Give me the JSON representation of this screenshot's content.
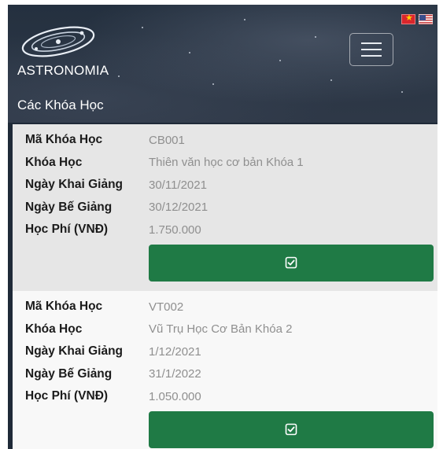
{
  "brand": {
    "name": "ASTRONOMIA"
  },
  "languages": [
    {
      "code": "vi",
      "icon": "vietnam-flag-icon"
    },
    {
      "code": "en",
      "icon": "us-flag-icon"
    }
  ],
  "nav": {
    "menu_icon": "hamburger-menu-icon"
  },
  "section": {
    "title": "Các Khóa Học"
  },
  "labels": {
    "code": "Mã Khóa Học",
    "course": "Khóa Học",
    "start": "Ngày Khai Giảng",
    "end": "Ngày Bế Giảng",
    "fee": "Học Phí (VNĐ)"
  },
  "courses": [
    {
      "code": "CB001",
      "name": "Thiên văn học cơ bản Khóa 1",
      "start": "30/11/2021",
      "end": "30/12/2021",
      "fee": "1.750.000",
      "button_icon": "checkbox-check-icon"
    },
    {
      "code": "VT002",
      "name": "Vũ Trụ Học Cơ Bản Khóa 2",
      "start": "1/12/2021",
      "end": "31/1/2022",
      "fee": "1.050.000",
      "button_icon": "checkbox-check-icon"
    }
  ],
  "colors": {
    "header_bg": "#24303f",
    "accent_green": "#1f7a45",
    "card_alt_bg": "#e6e6e6",
    "card_bg": "#f8f8f8",
    "value_text": "#8f8f8f"
  }
}
